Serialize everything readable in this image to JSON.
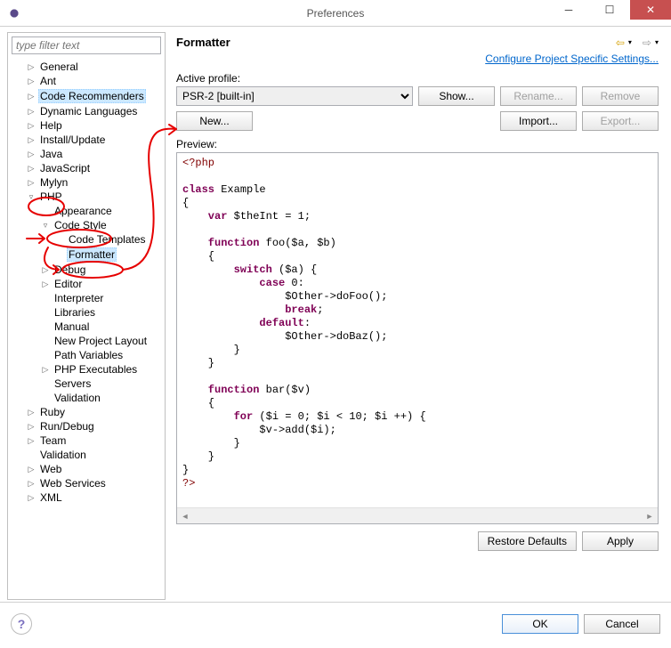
{
  "window": {
    "title": "Preferences"
  },
  "filter": {
    "placeholder": "type filter text"
  },
  "tree": {
    "general": "General",
    "ant": "Ant",
    "code_recommenders": "Code Recommenders",
    "dynamic_languages": "Dynamic Languages",
    "help": "Help",
    "install_update": "Install/Update",
    "java": "Java",
    "javascript": "JavaScript",
    "mylyn": "Mylyn",
    "php": "PHP",
    "php_appearance": "Appearance",
    "php_code_style": "Code Style",
    "php_code_templates": "Code Templates",
    "php_formatter": "Formatter",
    "php_debug": "Debug",
    "php_editor": "Editor",
    "php_interpreter": "Interpreter",
    "php_libraries": "Libraries",
    "php_manual": "Manual",
    "php_new_project_layout": "New Project Layout",
    "php_path_variables": "Path Variables",
    "php_executables": "PHP Executables",
    "php_servers": "Servers",
    "php_validation": "Validation",
    "ruby": "Ruby",
    "run_debug": "Run/Debug",
    "team": "Team",
    "validation": "Validation",
    "web": "Web",
    "web_services": "Web Services",
    "xml": "XML"
  },
  "main": {
    "title": "Formatter",
    "config_link": "Configure Project Specific Settings...",
    "active_profile_label": "Active profile:",
    "active_profile_value": "PSR-2 [built-in]",
    "show": "Show...",
    "rename": "Rename...",
    "remove": "Remove",
    "new": "New...",
    "import": "Import...",
    "export": "Export...",
    "preview_label": "Preview:",
    "restore_defaults": "Restore Defaults",
    "apply": "Apply"
  },
  "code": {
    "open": "<?php",
    "l1": "class",
    "l1b": " Example",
    "l2": "{",
    "l3a": "    var",
    "l3b": " $theInt = 1;",
    "l4a": "    function",
    "l4b": " foo($a, $b)",
    "l5": "    {",
    "l6a": "        switch",
    "l6b": " ($a) {",
    "l7a": "            case",
    "l7b": " 0:",
    "l8": "                $Other->doFoo();",
    "l9a": "                break",
    "l9b": ";",
    "l10a": "            default",
    "l10b": ":",
    "l11": "                $Other->doBaz();",
    "l12": "        }",
    "l13": "    }",
    "l14a": "    function",
    "l14b": " bar($v)",
    "l15": "    {",
    "l16a": "        for",
    "l16b": " ($i = 0; $i < 10; $i ++) {",
    "l17": "            $v->add($i);",
    "l18": "        }",
    "l19": "    }",
    "l20": "}",
    "close": "?>"
  },
  "footer": {
    "ok": "OK",
    "cancel": "Cancel"
  }
}
